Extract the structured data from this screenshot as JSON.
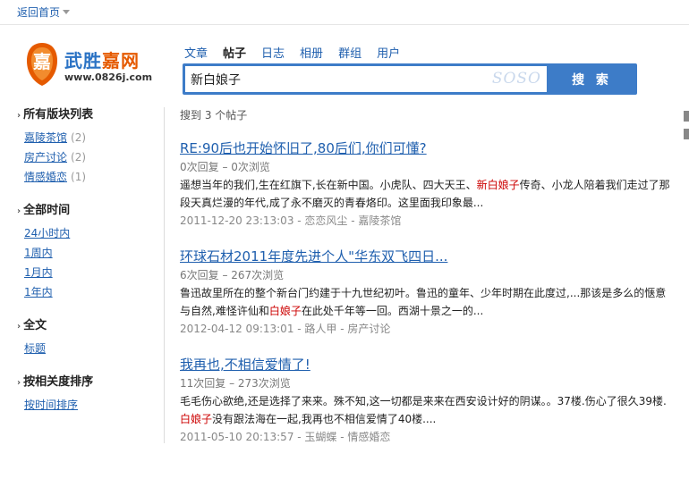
{
  "topbar": {
    "back_label": "返回首页"
  },
  "logo": {
    "mark_char": "嘉",
    "name_part1": "武胜",
    "name_part2": "嘉网",
    "url": "www.0826j.com"
  },
  "search": {
    "tabs": [
      {
        "label": "文章",
        "active": false
      },
      {
        "label": "帖子",
        "active": true
      },
      {
        "label": "日志",
        "active": false
      },
      {
        "label": "相册",
        "active": false
      },
      {
        "label": "群组",
        "active": false
      },
      {
        "label": "用户",
        "active": false
      }
    ],
    "query": "新白娘子",
    "watermark": "SOSO",
    "button_label": "搜 索"
  },
  "sidebar": {
    "groups": [
      {
        "title": "所有版块列表",
        "items": [
          {
            "label": "嘉陵茶馆",
            "count": "(2)"
          },
          {
            "label": "房产讨论",
            "count": "(2)"
          },
          {
            "label": "情感婚恋",
            "count": "(1)"
          }
        ]
      },
      {
        "title": "全部时间",
        "items": [
          {
            "label": "24小时内",
            "count": ""
          },
          {
            "label": "1周内",
            "count": ""
          },
          {
            "label": "1月内",
            "count": ""
          },
          {
            "label": "1年内",
            "count": ""
          }
        ]
      },
      {
        "title": "全文",
        "items": [
          {
            "label": "标题",
            "count": ""
          }
        ]
      },
      {
        "title": "按相关度排序",
        "items": [
          {
            "label": "按时间排序",
            "count": ""
          }
        ]
      }
    ]
  },
  "results": {
    "count_text": "搜到 3 个帖子",
    "items": [
      {
        "title": "RE:90后也开始怀旧了,80后们,你们可懂?",
        "stats": "0次回复 – 0次浏览",
        "snippet_before": "遥想当年的我们,生在红旗下,长在新中国。小虎队、四大天王、",
        "snippet_highlight": "新白娘子",
        "snippet_after": "传奇、小龙人陪着我们走过了那段天真烂漫的年代,成了永不磨灭的青春烙印。这里面我印象最...",
        "meta": "2011-12-20 23:13:03 - 恋恋风尘 - 嘉陵茶馆"
      },
      {
        "title": "环球石材2011年度先进个人\"华东双飞四日...",
        "stats": "6次回复 – 267次浏览",
        "snippet_before": "鲁迅故里所在的整个新台门约建于十九世纪初叶。鲁迅的童年、少年时期在此度过,...那该是多么的惬意与自然,难怪许仙和",
        "snippet_highlight": "白娘子",
        "snippet_after": "在此处千年等一回。西湖十景之一的...",
        "meta": "2012-04-12 09:13:01 - 路人甲 - 房产讨论"
      },
      {
        "title": "我再也,不相信爱情了!",
        "stats": "11次回复 – 273次浏览",
        "snippet_before": "毛毛伤心欲绝,还是选择了来来。殊不知,这一切都是来来在西安设计好的阴谋。。37楼.伤心了很久39楼.",
        "snippet_highlight": "白娘子",
        "snippet_after": "没有跟法海在一起,我再也不相信爱情了40楼....",
        "meta": "2011-05-10 20:13:57 - 玉蝴蝶 - 情感婚恋"
      }
    ]
  },
  "colors": {
    "link": "#1f5fae",
    "search_blue": "#3d7cc8",
    "highlight": "#cc0000",
    "logo_orange": "#e55a00"
  }
}
